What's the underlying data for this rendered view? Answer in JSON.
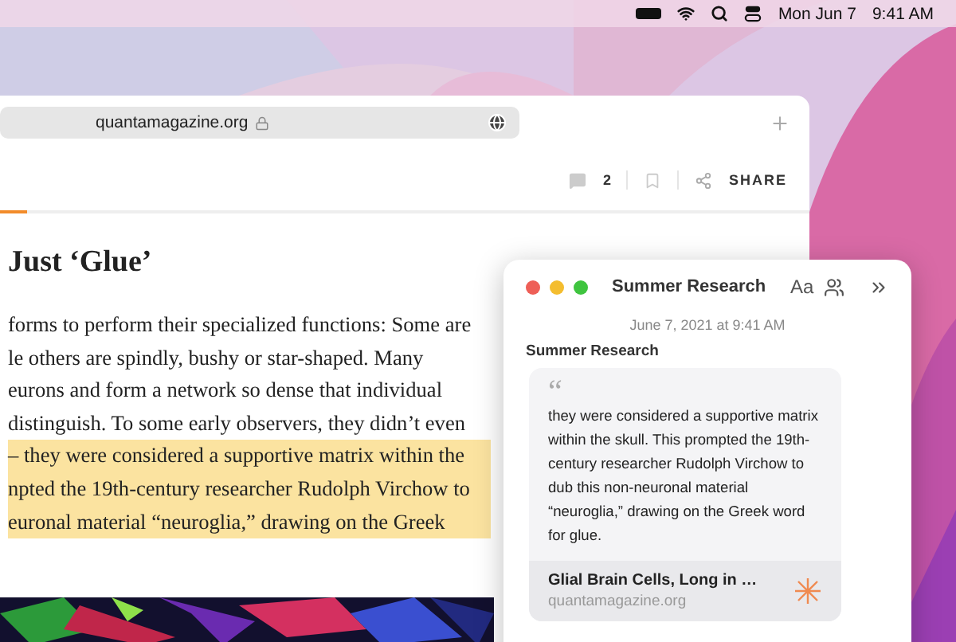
{
  "menu_bar": {
    "date": "Mon Jun 7",
    "time": "9:41 AM"
  },
  "browser": {
    "address": "quantamagazine.org",
    "comment_count": "2",
    "progress": {
      "level": 0.055
    },
    "share_label": "SHARE",
    "heading": "Just ‘Glue’",
    "lines": [
      {
        "text": "forms to perform their specialized functions: Some are",
        "highlighted": false
      },
      {
        "text": "le others are spindly, bushy or star-shaped. Many",
        "highlighted": false
      },
      {
        "text": "eurons and form a network so dense that individual",
        "highlighted": false
      },
      {
        "text": "distinguish. To some early observers, they didn’t even",
        "highlighted": false
      },
      {
        "text": "– they were considered a supportive matrix within the",
        "highlighted": true
      },
      {
        "text": "npted the 19th-century researcher Rudolph Virchow to",
        "highlighted": true
      },
      {
        "text": "euronal material “neuroglia,” drawing on the Greek",
        "highlighted": true
      }
    ]
  },
  "notes": {
    "title": "Summer Research",
    "font_button": "Aa",
    "date": "June 7, 2021 at 9:41 AM",
    "heading": "Summer Research",
    "quote_mark": "“",
    "quote": "they were considered a supportive matrix within the skull. This prompted the 19th-century researcher Rudolph Virchow to dub this non-neuronal material “neuroglia,” drawing on the Greek word for glue.",
    "link_title": "Glial Brain Cells, Long in …",
    "link_domain": "quantamagazine.org"
  }
}
